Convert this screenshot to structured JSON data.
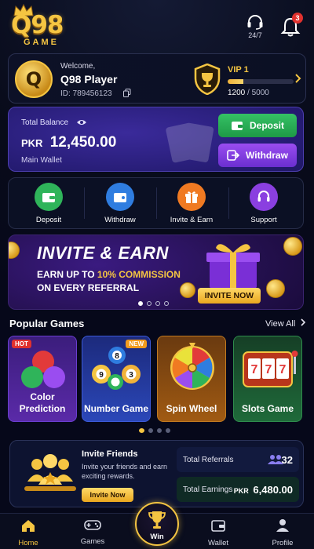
{
  "header": {
    "logo_top": "Q98",
    "logo_bottom": "GAME",
    "support_label": "24/7",
    "notification_count": "3"
  },
  "profile": {
    "avatar_letter": "Q",
    "welcome": "Welcome,",
    "name": "Player",
    "name_prefix": "Q98",
    "id_label": "ID: 789456123",
    "vip_level": "VIP 1",
    "vip_points": "1200",
    "vip_target": "/ 5000",
    "vip_progress_fraction": 0.24
  },
  "balance": {
    "label": "Total Balance",
    "currency": "PKR",
    "amount": "12,450.00",
    "wallet": "Main Wallet",
    "deposit_label": "Deposit",
    "withdraw_label": "Withdraw"
  },
  "actions": [
    {
      "label": "Deposit",
      "icon": "wallet-icon",
      "color": "#2fb45a"
    },
    {
      "label": "Withdraw",
      "icon": "wallet-out-icon",
      "color": "#2f7de0"
    },
    {
      "label": "Invite & Earn",
      "icon": "gift-icon",
      "color": "#f07a22"
    },
    {
      "label": "Support",
      "icon": "headset-icon",
      "color": "#8a3fe0"
    }
  ],
  "banner": {
    "title": "INVITE & EARN",
    "line1_prefix": "EARN UP TO ",
    "line1_highlight": "10% COMMISSION",
    "line2": "ON EVERY REFERRAL",
    "button": "INVITE NOW"
  },
  "games": {
    "title": "Popular Games",
    "view_all": "View All",
    "items": [
      {
        "name": "Color Prediction",
        "tag": "HOT"
      },
      {
        "name": "Number Game",
        "tag": "NEW"
      },
      {
        "name": "Spin Wheel",
        "tag": ""
      },
      {
        "name": "Slots Game",
        "tag": ""
      }
    ]
  },
  "invite": {
    "title": "Invite Friends",
    "subtitle": "Invite your friends and earn exciting rewards.",
    "button": "Invite Now",
    "referrals_label": "Total Referrals",
    "referrals_value": "32",
    "earnings_label": "Total Earnings",
    "earnings_currency": "PKR",
    "earnings_value": "6,480.00"
  },
  "nav": {
    "home": "Home",
    "games": "Games",
    "win": "Win",
    "wallet": "Wallet",
    "profile": "Profile"
  },
  "colors": {
    "accent_gold": "#f5c542",
    "deposit_green": "#2fb45a",
    "withdraw_purple": "#8a3fe0",
    "badge_red": "#e0312e"
  }
}
